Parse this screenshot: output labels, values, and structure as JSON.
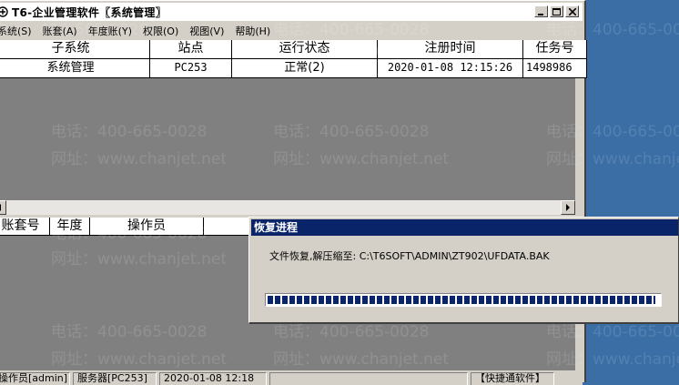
{
  "window": {
    "title": "T6-企业管理软件〖系统管理〗",
    "menu": [
      {
        "label": "系统(S)"
      },
      {
        "label": "账套(A)"
      },
      {
        "label": "年度账(Y)"
      },
      {
        "label": "权限(O)"
      },
      {
        "label": "视图(V)"
      },
      {
        "label": "帮助(H)"
      }
    ]
  },
  "process_table": {
    "headers": [
      "子系统",
      "站点",
      "运行状态",
      "注册时间",
      "任务号"
    ],
    "rows": [
      [
        "系统管理",
        "PC253",
        "正常(2)",
        "2020-01-08 12:15:26",
        "1498986"
      ]
    ]
  },
  "user_table": {
    "headers": [
      "账套号",
      "年度",
      "操作员",
      ""
    ]
  },
  "statusbar": {
    "operator": "操作员[admin]",
    "server": "服务器[PC253]",
    "datetime": "2020-01-08 12:18",
    "shortcut": "【快捷通软件】"
  },
  "watermark": {
    "phone": "电话：400-665-0028",
    "site": "网址：www.chanjet.net"
  },
  "dialog": {
    "title": "恢复进程",
    "message": "文件恢复,解压缩至: C:\\T6SOFT\\ADMIN\\ZT902\\UFDATA.BAK",
    "progress_percent": 99
  }
}
